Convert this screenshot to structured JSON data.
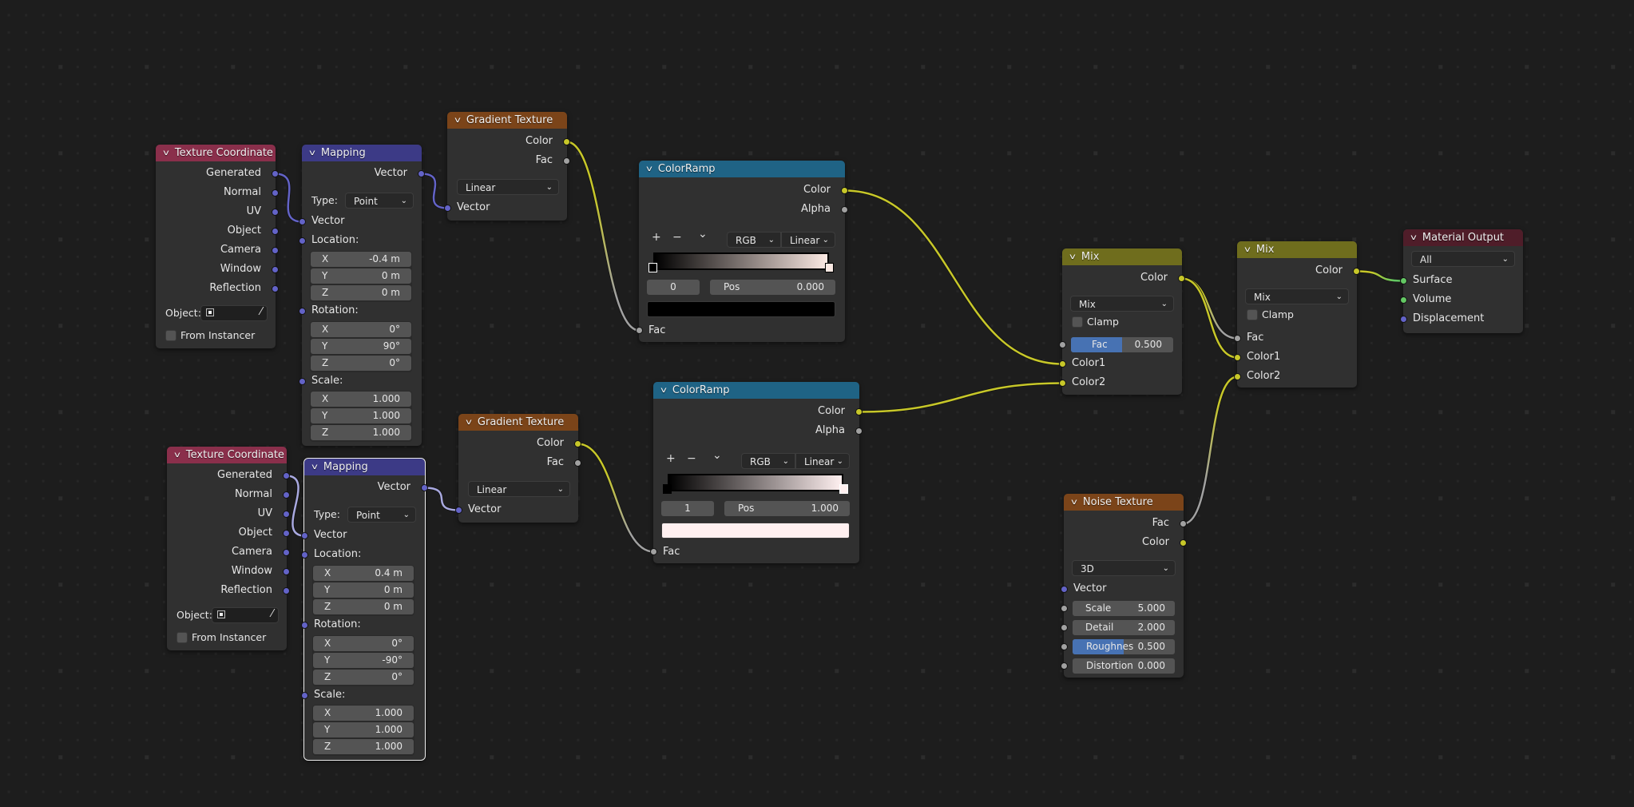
{
  "editor": "Shader Node Editor",
  "colors": {
    "background": "#1d1d1d",
    "node_body": "#303030",
    "header_texture_coordinate": "#8a2f4b",
    "header_vector": "#3c3a86",
    "header_texture": "#7b4419",
    "header_converter": "#1f6385",
    "header_color": "#6f6d1d",
    "header_output": "#4f1d29",
    "socket_vector": "#6363c7",
    "socket_color": "#c7c729",
    "socket_float": "#a1a1a1",
    "socket_shader": "#63c763",
    "slider_fill": "#4772b3"
  },
  "nodes": {
    "texcoord1": {
      "title": "Texture Coordinate",
      "outputs": [
        "Generated",
        "Normal",
        "UV",
        "Object",
        "Camera",
        "Window",
        "Reflection"
      ],
      "object_label": "Object:",
      "object_icon": "object-icon",
      "eyedropper_icon": "eyedropper-icon",
      "from_instancer": "From Instancer",
      "from_instancer_checked": false
    },
    "mapping1": {
      "title": "Mapping",
      "output": "Vector",
      "type_label": "Type:",
      "type_value": "Point",
      "vector_input": "Vector",
      "location_label": "Location:",
      "location": [
        {
          "axis": "X",
          "value": "-0.4 m"
        },
        {
          "axis": "Y",
          "value": "0 m"
        },
        {
          "axis": "Z",
          "value": "0 m"
        }
      ],
      "rotation_label": "Rotation:",
      "rotation": [
        {
          "axis": "X",
          "value": "0°"
        },
        {
          "axis": "Y",
          "value": "90°"
        },
        {
          "axis": "Z",
          "value": "0°"
        }
      ],
      "scale_label": "Scale:",
      "scale": [
        {
          "axis": "X",
          "value": "1.000"
        },
        {
          "axis": "Y",
          "value": "1.000"
        },
        {
          "axis": "Z",
          "value": "1.000"
        }
      ]
    },
    "gradient1": {
      "title": "Gradient Texture",
      "outputs": [
        "Color",
        "Fac"
      ],
      "type_value": "Linear",
      "input": "Vector"
    },
    "colorramp1": {
      "title": "ColorRamp",
      "outputs": [
        "Color",
        "Alpha"
      ],
      "add": "+",
      "remove": "−",
      "menu": "⌄",
      "color_mode": "RGB",
      "interpolation": "Linear",
      "active_index": "0",
      "pos_label": "Pos",
      "pos_value": "0.000",
      "active_color": "#000000",
      "gradient_start": "#000000",
      "gradient_end": "#fbe9e3",
      "input": "Fac"
    },
    "texcoord2": {
      "title": "Texture Coordinate",
      "outputs": [
        "Generated",
        "Normal",
        "UV",
        "Object",
        "Camera",
        "Window",
        "Reflection"
      ],
      "object_label": "Object:",
      "from_instancer": "From Instancer",
      "from_instancer_checked": false
    },
    "mapping2": {
      "title": "Mapping",
      "selected": true,
      "output": "Vector",
      "type_label": "Type:",
      "type_value": "Point",
      "vector_input": "Vector",
      "location_label": "Location:",
      "location": [
        {
          "axis": "X",
          "value": "0.4 m"
        },
        {
          "axis": "Y",
          "value": "0 m"
        },
        {
          "axis": "Z",
          "value": "0 m"
        }
      ],
      "rotation_label": "Rotation:",
      "rotation": [
        {
          "axis": "X",
          "value": "0°"
        },
        {
          "axis": "Y",
          "value": "-90°"
        },
        {
          "axis": "Z",
          "value": "0°"
        }
      ],
      "scale_label": "Scale:",
      "scale": [
        {
          "axis": "X",
          "value": "1.000"
        },
        {
          "axis": "Y",
          "value": "1.000"
        },
        {
          "axis": "Z",
          "value": "1.000"
        }
      ]
    },
    "gradient2": {
      "title": "Gradient Texture",
      "outputs": [
        "Color",
        "Fac"
      ],
      "type_value": "Linear",
      "input": "Vector"
    },
    "colorramp2": {
      "title": "ColorRamp",
      "outputs": [
        "Color",
        "Alpha"
      ],
      "add": "+",
      "remove": "−",
      "menu": "⌄",
      "color_mode": "RGB",
      "interpolation": "Linear",
      "active_index": "1",
      "pos_label": "Pos",
      "pos_value": "1.000",
      "active_color": "#fff0f0",
      "gradient_start": "#000000",
      "gradient_end": "#fff0f0",
      "input": "Fac"
    },
    "mix1": {
      "title": "Mix",
      "output": "Color",
      "blend_mode": "Mix",
      "clamp": "Clamp",
      "clamp_checked": false,
      "fac_label": "Fac",
      "fac_value": "0.500",
      "fac_fraction": 0.5,
      "inputs": [
        "Color1",
        "Color2"
      ]
    },
    "mix2": {
      "title": "Mix",
      "output": "Color",
      "blend_mode": "Mix",
      "clamp": "Clamp",
      "clamp_checked": false,
      "inputs": [
        "Fac",
        "Color1",
        "Color2"
      ]
    },
    "noise": {
      "title": "Noise Texture",
      "outputs": [
        "Fac",
        "Color"
      ],
      "dimensions": "3D",
      "vector_input": "Vector",
      "fields": [
        {
          "label": "Scale",
          "value": "5.000"
        },
        {
          "label": "Detail",
          "value": "2.000"
        },
        {
          "label": "Roughnes",
          "value": "0.500",
          "fraction": 0.5
        },
        {
          "label": "Distortion",
          "value": "0.000"
        }
      ]
    },
    "output": {
      "title": "Material Output",
      "target": "All",
      "inputs": [
        "Surface",
        "Volume",
        "Displacement"
      ]
    }
  },
  "links": [
    {
      "from": "texcoord1.Generated",
      "to": "mapping1.Vector",
      "type": "vector"
    },
    {
      "from": "mapping1.Vector",
      "to": "gradient1.Vector",
      "type": "vector"
    },
    {
      "from": "gradient1.Color",
      "to": "colorramp1.Fac",
      "type": "color-float"
    },
    {
      "from": "colorramp1.Color",
      "to": "mix1.Color1",
      "type": "color"
    },
    {
      "from": "texcoord2.Generated",
      "to": "mapping2.Vector",
      "type": "vector-selected"
    },
    {
      "from": "mapping2.Vector",
      "to": "gradient2.Vector",
      "type": "vector-selected"
    },
    {
      "from": "gradient2.Color",
      "to": "colorramp2.Fac",
      "type": "color-float"
    },
    {
      "from": "colorramp2.Color",
      "to": "mix1.Color2",
      "type": "color"
    },
    {
      "from": "mix1.Color",
      "to": "mix2.Fac",
      "type": "color-float"
    },
    {
      "from": "mix1.Color",
      "to": "mix2.Color1",
      "type": "color"
    },
    {
      "from": "noise.Fac",
      "to": "mix2.Color2",
      "type": "float-color"
    },
    {
      "from": "mix2.Color",
      "to": "output.Surface",
      "type": "color-shader"
    }
  ]
}
